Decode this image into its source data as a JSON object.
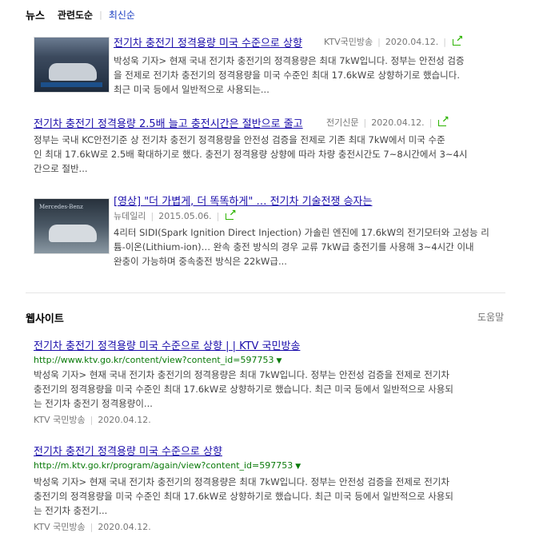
{
  "news": {
    "heading": "뉴스",
    "sort_relevance": "관련도순",
    "sort_recent": "최신순",
    "items": [
      {
        "title": "전기차 충전기 정격용량 미국 수준으로 상향",
        "source": "KTV국민방송",
        "date": "2020.04.12.",
        "desc_lines": [
          "박성욱 기자> 현재 국내 전기차 충전기의 정격용량은 최대 7kW입니다. 정부는 안전성 검증",
          "을 전제로 전기차 충전기의 정격용량을 미국 수준인 최대 17.6kW로 상향하기로 했습니다.",
          "최근 미국 등에서 일반적으로 사용되는..."
        ]
      },
      {
        "title": "전기차 충전기 정격용량 2.5배 늘고 충전시간은 절반으로 줄고",
        "source": "전기신문",
        "date": "2020.04.12.",
        "desc_lines": [
          "정부는 국내 KC안전기준 상 전기차 충전기 정격용량을 안전성 검증을 전제로 기존 최대 7kW에서 미국 수준",
          "인 최대 17.6kW로 2.5배 확대하기로 했다. 충전기 정격용량 상향에 따라 차량 충전시간도 7~8시간에서 3~4시",
          "간으로 절반..."
        ]
      },
      {
        "title": "[영상] \"더 가볍게, 더 똑똑하게\" … 전기차 기술전쟁 승자는",
        "source": "뉴데일리",
        "date": "2015.05.06.",
        "thumb_text": "Mercedes-Benz",
        "desc_lines": [
          "4리터 SIDI(Spark Ignition Direct Injection) 가솔린 엔진에 17.6kW의 전기모터와 고성능 리",
          "튬-이온(Lithium-ion)… 완속 충전 방식의 경우 교류 7kW급 충전기를 사용해 3~4시간 이내",
          "완충이 가능하며 중속충전 방식은 22kW급..."
        ]
      }
    ]
  },
  "web": {
    "heading": "웹사이트",
    "help": "도움말",
    "items": [
      {
        "title": "전기차 충전기 정격용량 미국 수준으로 상향 | | KTV 국민방송",
        "url": "http://www.ktv.go.kr/content/view?content_id=597753",
        "desc_lines": [
          "박성욱 기자> 현재 국내 전기차 충전기의 정격용량은 최대 7kW입니다. 정부는 안전성 검증을 전제로 전기차",
          "충전기의 정격용량을 미국 수준인 최대 17.6kW로 상향하기로 했습니다. 최근 미국 등에서 일반적으로 사용되",
          "는 전기차 충전기 정격용량이..."
        ],
        "source": "KTV 국민방송",
        "date": "2020.04.12."
      },
      {
        "title": "전기차 충전기 정격용량 미국 수준으로 상향",
        "url": "http://m.ktv.go.kr/program/again/view?content_id=597753",
        "desc_lines": [
          "박성욱 기자> 현재 국내 전기차 충전기의 정격용량은 최대 7kW입니다. 정부는 안전성 검증을 전제로 전기차",
          "충전기의 정격용량을 미국 수준인 최대 17.6kW로 상향하기로 했습니다. 최근 미국 등에서 일반적으로 사용되",
          "는 전기차 충전기..."
        ],
        "source": "KTV 국민방송",
        "date": "2020.04.12."
      }
    ]
  },
  "colors": {
    "link": "#1a0dab",
    "url": "#0a7a0a",
    "accent": "#2db400"
  },
  "icons": {
    "share": "share-icon",
    "url_dropdown": "chevron-down-icon"
  }
}
